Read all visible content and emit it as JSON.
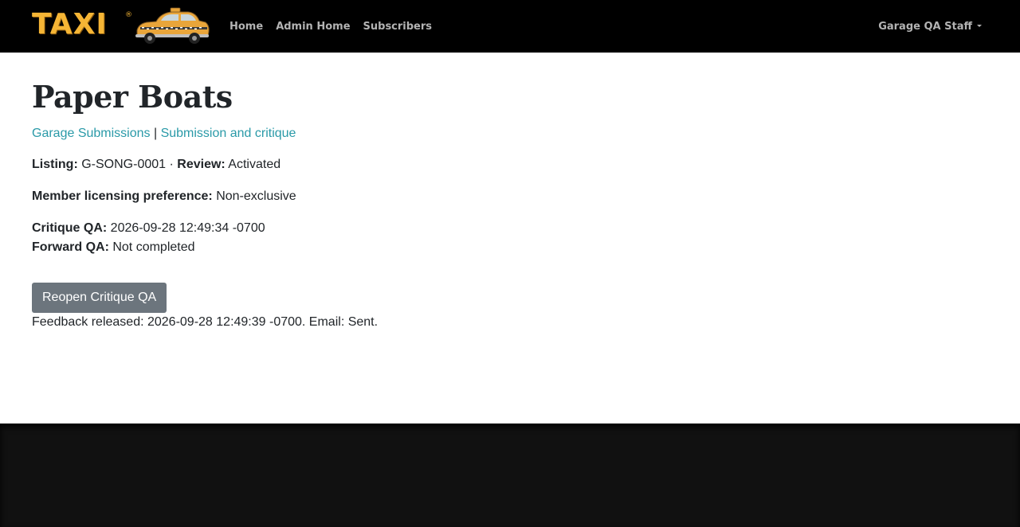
{
  "navbar": {
    "logo_text": "TAXI",
    "logo_reg": "®",
    "links": [
      "Home",
      "Admin Home",
      "Subscribers"
    ],
    "user_menu_label": "Garage QA Staff"
  },
  "page": {
    "title": "Paper Boats",
    "breadcrumb": {
      "link1": "Garage Submissions",
      "separator": "|",
      "link2": "Submission and critique"
    },
    "listing_label": "Listing:",
    "listing_value": "G-SONG-0001",
    "dot": "·",
    "review_label": "Review:",
    "review_value": "Activated",
    "licensing_label": "Member licensing preference:",
    "licensing_value": "Non-exclusive",
    "critique_qa_label": "Critique QA:",
    "critique_qa_value": "2026-09-28 12:49:34 -0700",
    "forward_qa_label": "Forward QA:",
    "forward_qa_value": "Not completed",
    "reopen_button": "Reopen Critique QA",
    "feedback_text": "Feedback released: 2026-09-28 12:49:39 -0700. Email: Sent."
  },
  "colors": {
    "navbar_bg": "#000000",
    "logo": "#f5b535",
    "link": "#2a9aa8",
    "button_bg": "#6c757d",
    "footer_bg": "#111111"
  }
}
